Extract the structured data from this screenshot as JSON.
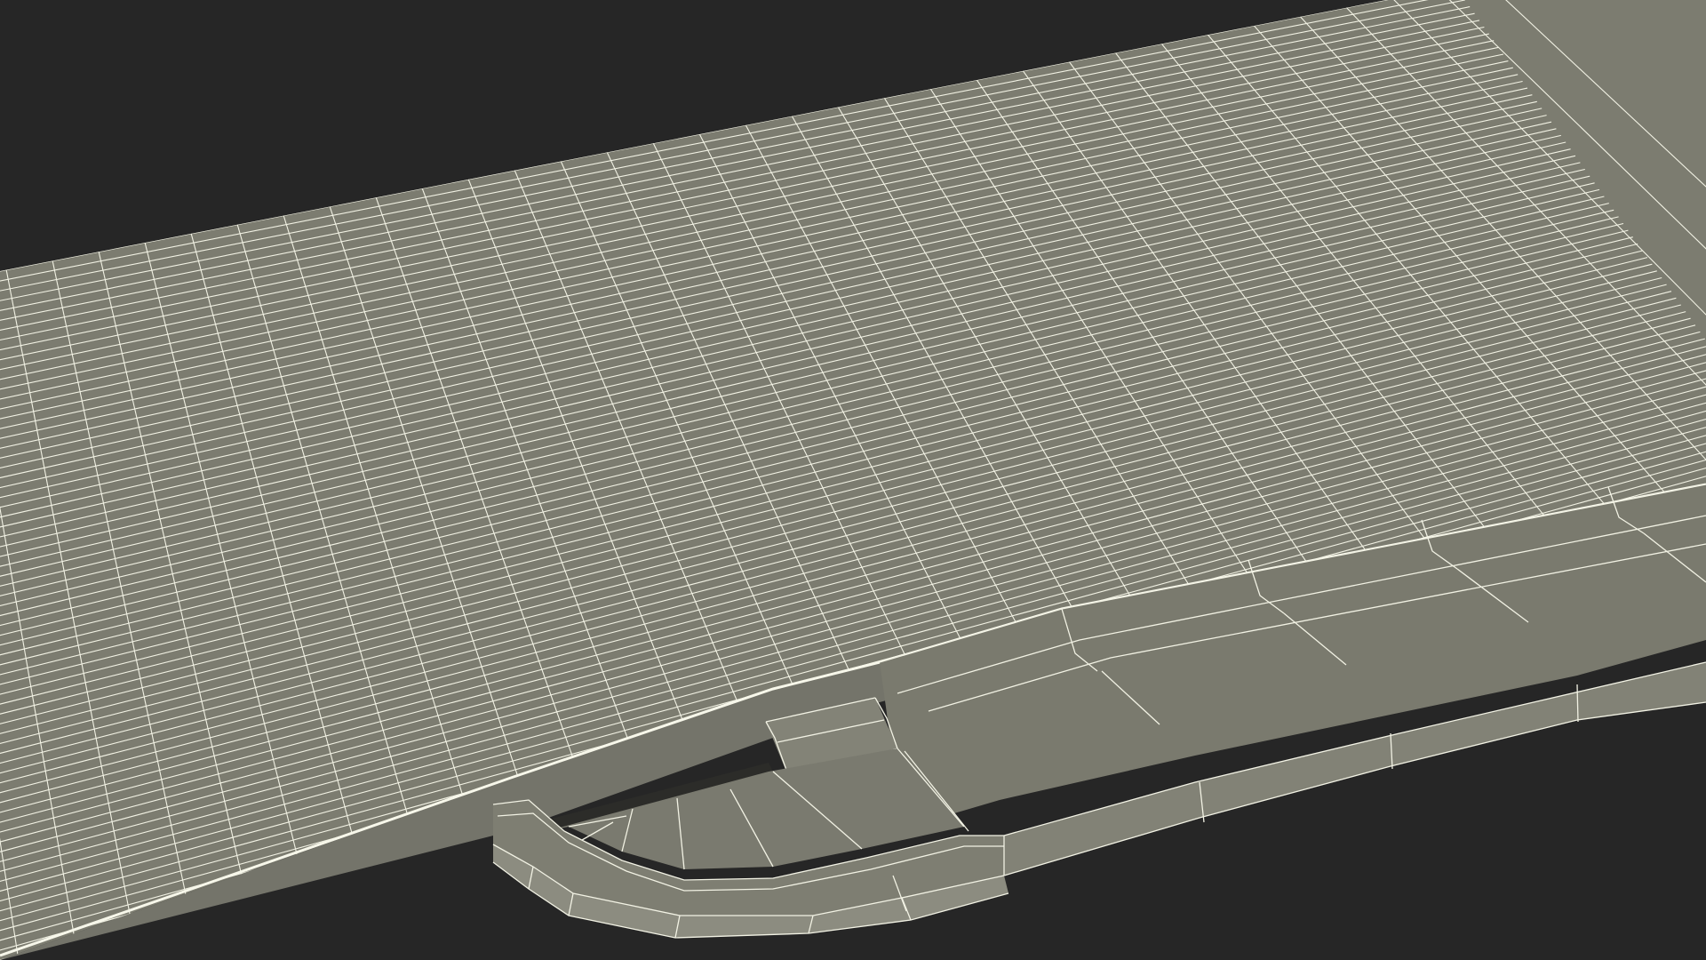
{
  "scene": {
    "subject": "wireframe-3d-model",
    "colors": {
      "background": "#262626",
      "surface": "#7c7c70",
      "surface_shade": "#6f6f64",
      "side_face": "#8a8a7e",
      "wire": "#f2f2e4",
      "shadow": "#3a3a35"
    }
  }
}
